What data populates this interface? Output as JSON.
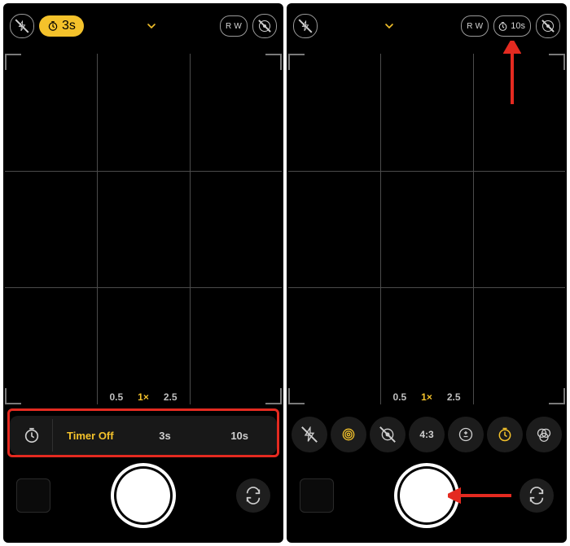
{
  "left": {
    "top": {
      "timer_badge": "3s",
      "raw_label": "R W"
    },
    "zoom": {
      "opt1": "0.5",
      "opt2": "1×",
      "opt3": "2.5"
    },
    "timer_row": {
      "off": "Timer Off",
      "opt_3s": "3s",
      "opt_10s": "10s"
    }
  },
  "right": {
    "top": {
      "raw_label": "R W",
      "timer_badge": "10s"
    },
    "zoom": {
      "opt1": "0.5",
      "opt2": "1×",
      "opt3": "2.5"
    },
    "controls": {
      "aspect": "4:3"
    }
  }
}
